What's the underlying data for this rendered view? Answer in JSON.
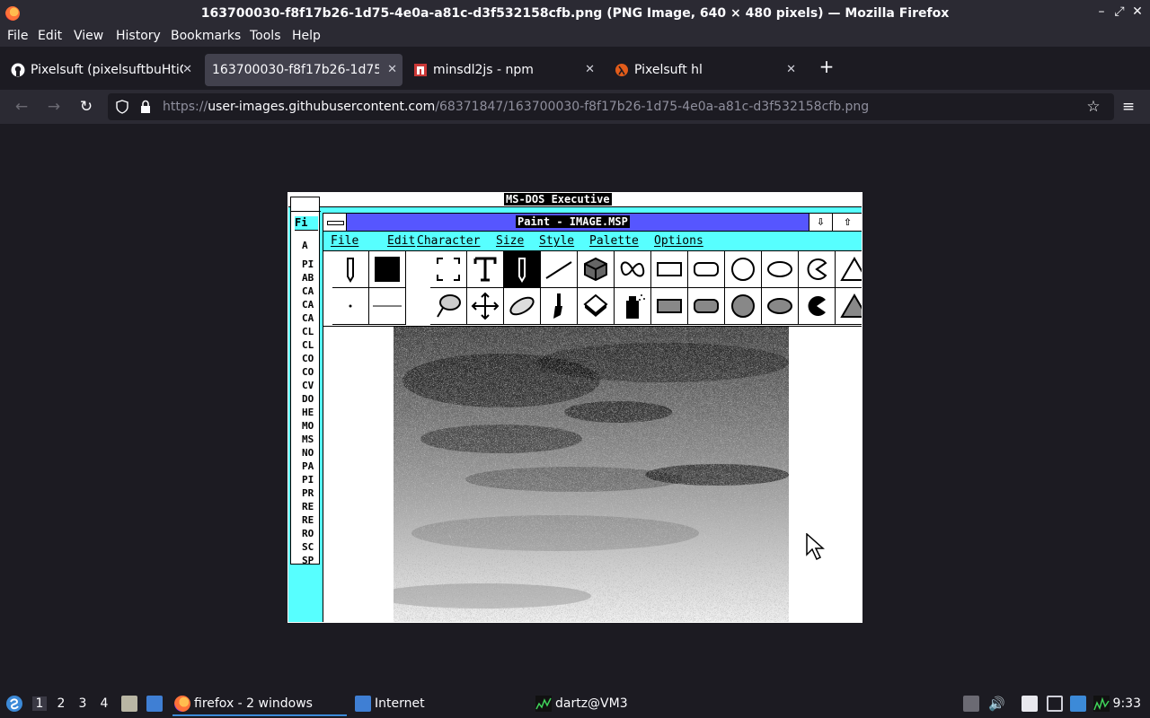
{
  "window": {
    "title": "163700030-f8f17b26-1d75-4e0a-a81c-d3f532158cfb.png (PNG Image, 640 × 480 pixels) — Mozilla Firefox",
    "controls": [
      "–",
      "⤢",
      "✕"
    ]
  },
  "menubar": {
    "items": [
      "File",
      "Edit",
      "View",
      "History",
      "Bookmarks",
      "Tools",
      "Help"
    ]
  },
  "tabs": [
    {
      "label": "Pixelsuft (pixelsuftbuHtiC",
      "active": false,
      "icon": "github-icon"
    },
    {
      "label": "163700030-f8f17b26-1d75-",
      "active": true,
      "icon": "none"
    },
    {
      "label": "minsdl2js - npm",
      "active": false,
      "icon": "npm-icon"
    },
    {
      "label": "Pixelsuft hl",
      "active": false,
      "icon": "half-life-icon"
    }
  ],
  "newtab_label": "+",
  "navbar": {
    "url_prefix": "https://",
    "url_host": "user-images.githubusercontent.com",
    "url_path": "/68371847/163700030-f8f17b26-1d75-4e0a-a81c-d3f532158cfb.png"
  },
  "screenshot": {
    "dos_title": "MS-DOS Executive",
    "dos_menu": "Fi",
    "dos_drive": "A",
    "dos_files": [
      "PI",
      "AB",
      "CA",
      "CA",
      "CA",
      "CL",
      "CL",
      "CO",
      "CO",
      "CV",
      "DO",
      "HE",
      "MO",
      "MS",
      "NO",
      "PA",
      "PI",
      "PR",
      "RE",
      "RE",
      "RO",
      "SC",
      "SP"
    ],
    "paint_title": "Paint - IMAGE.MSP",
    "paint_controls": [
      "⇩",
      "⇧"
    ],
    "paint_menu": [
      "File",
      "Edit",
      "Character",
      "Size",
      "Style",
      "Palette",
      "Options"
    ]
  },
  "taskbar": {
    "workspaces": [
      "1",
      "2",
      "3",
      "4"
    ],
    "tasks": [
      {
        "label": "firefox - 2 windows",
        "icon": "firefox-icon"
      },
      {
        "label": "Internet",
        "icon": "folder-icon"
      },
      {
        "label": "dartz@VM3",
        "icon": "terminal-icon"
      }
    ],
    "clock": "9:33"
  },
  "colors": {
    "dos_cyan": "#57ffff",
    "paint_title_blue": "#5656ff",
    "browser_bg": "#1c1b22"
  }
}
